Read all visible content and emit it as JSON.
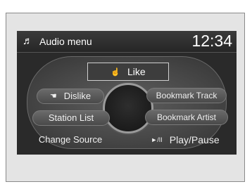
{
  "header": {
    "title": "Audio menu",
    "time": "12:34",
    "music_icon": "♬"
  },
  "menu": {
    "like": {
      "icon": "☝",
      "label": "Like"
    },
    "dislike": {
      "icon": "☚",
      "label": "Dislike"
    },
    "station_list": {
      "label": "Station List"
    },
    "change_source": {
      "label": "Change Source"
    },
    "bookmark_track": {
      "label": "Bookmark Track"
    },
    "bookmark_artist": {
      "label": "Bookmark Artist"
    },
    "play_pause": {
      "icon": "►/II",
      "label": "Play/Pause"
    }
  }
}
